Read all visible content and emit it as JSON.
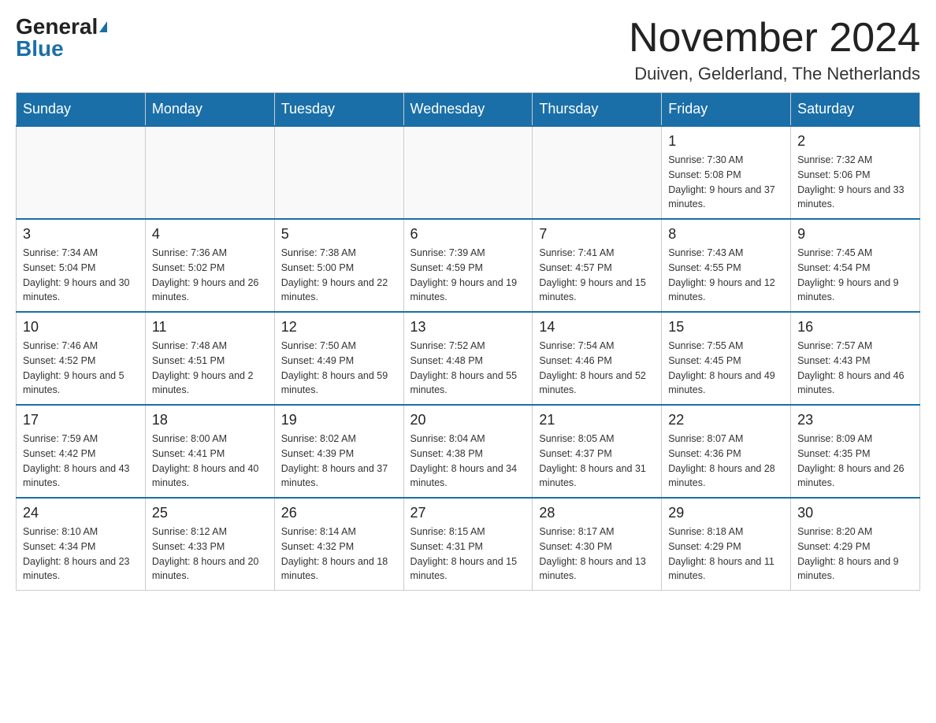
{
  "logo": {
    "general": "General",
    "blue": "Blue"
  },
  "title": "November 2024",
  "location": "Duiven, Gelderland, The Netherlands",
  "days_of_week": [
    "Sunday",
    "Monday",
    "Tuesday",
    "Wednesday",
    "Thursday",
    "Friday",
    "Saturday"
  ],
  "weeks": [
    [
      {
        "day": "",
        "info": ""
      },
      {
        "day": "",
        "info": ""
      },
      {
        "day": "",
        "info": ""
      },
      {
        "day": "",
        "info": ""
      },
      {
        "day": "",
        "info": ""
      },
      {
        "day": "1",
        "info": "Sunrise: 7:30 AM\nSunset: 5:08 PM\nDaylight: 9 hours and 37 minutes."
      },
      {
        "day": "2",
        "info": "Sunrise: 7:32 AM\nSunset: 5:06 PM\nDaylight: 9 hours and 33 minutes."
      }
    ],
    [
      {
        "day": "3",
        "info": "Sunrise: 7:34 AM\nSunset: 5:04 PM\nDaylight: 9 hours and 30 minutes."
      },
      {
        "day": "4",
        "info": "Sunrise: 7:36 AM\nSunset: 5:02 PM\nDaylight: 9 hours and 26 minutes."
      },
      {
        "day": "5",
        "info": "Sunrise: 7:38 AM\nSunset: 5:00 PM\nDaylight: 9 hours and 22 minutes."
      },
      {
        "day": "6",
        "info": "Sunrise: 7:39 AM\nSunset: 4:59 PM\nDaylight: 9 hours and 19 minutes."
      },
      {
        "day": "7",
        "info": "Sunrise: 7:41 AM\nSunset: 4:57 PM\nDaylight: 9 hours and 15 minutes."
      },
      {
        "day": "8",
        "info": "Sunrise: 7:43 AM\nSunset: 4:55 PM\nDaylight: 9 hours and 12 minutes."
      },
      {
        "day": "9",
        "info": "Sunrise: 7:45 AM\nSunset: 4:54 PM\nDaylight: 9 hours and 9 minutes."
      }
    ],
    [
      {
        "day": "10",
        "info": "Sunrise: 7:46 AM\nSunset: 4:52 PM\nDaylight: 9 hours and 5 minutes."
      },
      {
        "day": "11",
        "info": "Sunrise: 7:48 AM\nSunset: 4:51 PM\nDaylight: 9 hours and 2 minutes."
      },
      {
        "day": "12",
        "info": "Sunrise: 7:50 AM\nSunset: 4:49 PM\nDaylight: 8 hours and 59 minutes."
      },
      {
        "day": "13",
        "info": "Sunrise: 7:52 AM\nSunset: 4:48 PM\nDaylight: 8 hours and 55 minutes."
      },
      {
        "day": "14",
        "info": "Sunrise: 7:54 AM\nSunset: 4:46 PM\nDaylight: 8 hours and 52 minutes."
      },
      {
        "day": "15",
        "info": "Sunrise: 7:55 AM\nSunset: 4:45 PM\nDaylight: 8 hours and 49 minutes."
      },
      {
        "day": "16",
        "info": "Sunrise: 7:57 AM\nSunset: 4:43 PM\nDaylight: 8 hours and 46 minutes."
      }
    ],
    [
      {
        "day": "17",
        "info": "Sunrise: 7:59 AM\nSunset: 4:42 PM\nDaylight: 8 hours and 43 minutes."
      },
      {
        "day": "18",
        "info": "Sunrise: 8:00 AM\nSunset: 4:41 PM\nDaylight: 8 hours and 40 minutes."
      },
      {
        "day": "19",
        "info": "Sunrise: 8:02 AM\nSunset: 4:39 PM\nDaylight: 8 hours and 37 minutes."
      },
      {
        "day": "20",
        "info": "Sunrise: 8:04 AM\nSunset: 4:38 PM\nDaylight: 8 hours and 34 minutes."
      },
      {
        "day": "21",
        "info": "Sunrise: 8:05 AM\nSunset: 4:37 PM\nDaylight: 8 hours and 31 minutes."
      },
      {
        "day": "22",
        "info": "Sunrise: 8:07 AM\nSunset: 4:36 PM\nDaylight: 8 hours and 28 minutes."
      },
      {
        "day": "23",
        "info": "Sunrise: 8:09 AM\nSunset: 4:35 PM\nDaylight: 8 hours and 26 minutes."
      }
    ],
    [
      {
        "day": "24",
        "info": "Sunrise: 8:10 AM\nSunset: 4:34 PM\nDaylight: 8 hours and 23 minutes."
      },
      {
        "day": "25",
        "info": "Sunrise: 8:12 AM\nSunset: 4:33 PM\nDaylight: 8 hours and 20 minutes."
      },
      {
        "day": "26",
        "info": "Sunrise: 8:14 AM\nSunset: 4:32 PM\nDaylight: 8 hours and 18 minutes."
      },
      {
        "day": "27",
        "info": "Sunrise: 8:15 AM\nSunset: 4:31 PM\nDaylight: 8 hours and 15 minutes."
      },
      {
        "day": "28",
        "info": "Sunrise: 8:17 AM\nSunset: 4:30 PM\nDaylight: 8 hours and 13 minutes."
      },
      {
        "day": "29",
        "info": "Sunrise: 8:18 AM\nSunset: 4:29 PM\nDaylight: 8 hours and 11 minutes."
      },
      {
        "day": "30",
        "info": "Sunrise: 8:20 AM\nSunset: 4:29 PM\nDaylight: 8 hours and 9 minutes."
      }
    ]
  ]
}
